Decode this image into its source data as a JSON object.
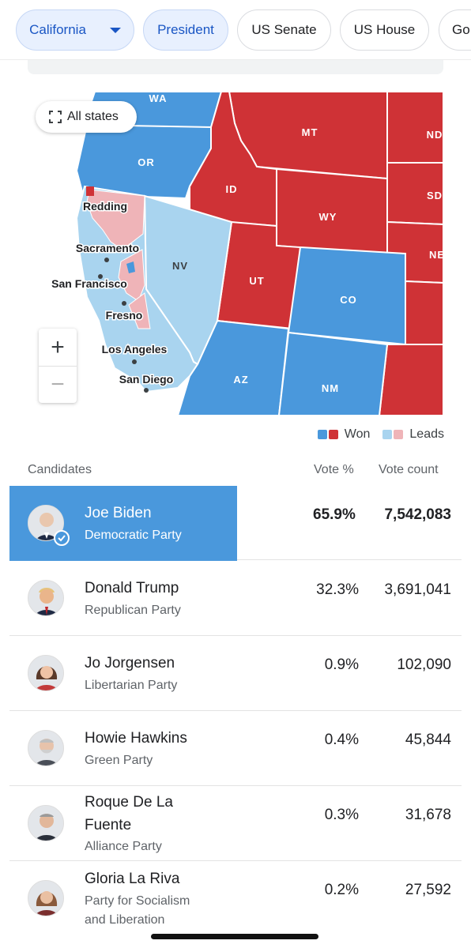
{
  "chips": {
    "state": "California",
    "president": "President",
    "senate": "US Senate",
    "house": "US House",
    "governor": "Go"
  },
  "map": {
    "all_states": "All states",
    "zoom_in": "+",
    "zoom_out": "−",
    "states": {
      "WA": "WA",
      "OR": "OR",
      "ID": "ID",
      "MT": "MT",
      "ND": "ND",
      "SD": "SD",
      "WY": "WY",
      "NE": "NE",
      "NV": "NV",
      "UT": "UT",
      "CO": "CO",
      "AZ": "AZ",
      "NM": "NM"
    },
    "cities": {
      "redding": "Redding",
      "sacramento": "Sacramento",
      "san_francisco": "San Francisco",
      "fresno": "Fresno",
      "los_angeles": "Los Angeles",
      "san_diego": "San Diego"
    },
    "colors": {
      "dem_won": "#4a98dc",
      "rep_won": "#cf3236",
      "dem_leads": "#a9d4ef",
      "rep_leads": "#efb4b8"
    }
  },
  "legend": {
    "won": "Won",
    "leads": "Leads"
  },
  "table": {
    "headers": {
      "candidates": "Candidates",
      "vote_pct": "Vote %",
      "vote_count": "Vote count"
    },
    "rows": [
      {
        "name": "Joe Biden",
        "party": "Democratic Party",
        "pct": "65.9%",
        "count": "7,542,083",
        "winner": true
      },
      {
        "name": "Donald Trump",
        "party": "Republican Party",
        "pct": "32.3%",
        "count": "3,691,041"
      },
      {
        "name": "Jo Jorgensen",
        "party": "Libertarian Party",
        "pct": "0.9%",
        "count": "102,090"
      },
      {
        "name": "Howie Hawkins",
        "party": "Green Party",
        "pct": "0.4%",
        "count": "45,844"
      },
      {
        "name_line1": "Roque De La",
        "name_line2": "Fuente",
        "party": "Alliance Party",
        "pct": "0.3%",
        "count": "31,678"
      },
      {
        "name": "Gloria La Riva",
        "party_line1": "Party for Socialism",
        "party_line2": "and Liberation",
        "pct": "0.2%",
        "count": "27,592"
      }
    ]
  }
}
